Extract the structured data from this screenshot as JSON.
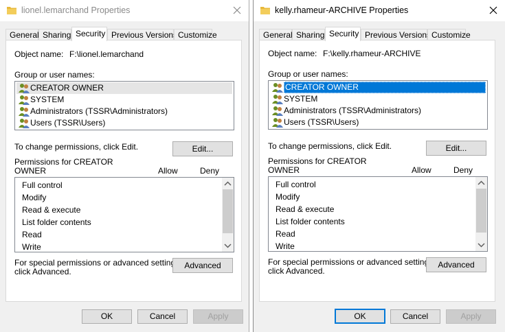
{
  "left": {
    "title": "lionel.lemarchand Properties",
    "tabs": [
      "General",
      "Sharing",
      "Security",
      "Previous Versions",
      "Customize"
    ],
    "object_name_label": "Object name:",
    "object_name_value": "F:\\lionel.lemarchand",
    "group_label": "Group or user names:",
    "users": [
      "CREATOR OWNER",
      "SYSTEM",
      "Administrators (TSSR\\Administrators)",
      "Users (TSSR\\Users)"
    ],
    "change_text": "To change permissions, click Edit.",
    "edit_button": "Edit...",
    "perm_for_line1": "Permissions for CREATOR",
    "perm_for_line2": "OWNER",
    "allow_label": "Allow",
    "deny_label": "Deny",
    "permissions": [
      "Full control",
      "Modify",
      "Read & execute",
      "List folder contents",
      "Read",
      "Write"
    ],
    "special_line1": "For special permissions or advanced settings,",
    "special_line2": "click Advanced.",
    "advanced_button": "Advanced",
    "ok_button": "OK",
    "cancel_button": "Cancel",
    "apply_button": "Apply"
  },
  "right": {
    "title": "kelly.rhameur-ARCHIVE Properties",
    "tabs": [
      "General",
      "Sharing",
      "Security",
      "Previous Versions",
      "Customize"
    ],
    "object_name_label": "Object name:",
    "object_name_value": "F:\\kelly.rhameur-ARCHIVE",
    "group_label": "Group or user names:",
    "users": [
      "CREATOR OWNER",
      "SYSTEM",
      "Administrators (TSSR\\Administrators)",
      "Users (TSSR\\Users)"
    ],
    "change_text": "To change permissions, click Edit.",
    "edit_button": "Edit...",
    "perm_for_line1": "Permissions for CREATOR",
    "perm_for_line2": "OWNER",
    "allow_label": "Allow",
    "deny_label": "Deny",
    "permissions": [
      "Full control",
      "Modify",
      "Read & execute",
      "List folder contents",
      "Read",
      "Write"
    ],
    "special_line1": "For special permissions or advanced settings,",
    "special_line2": "click Advanced.",
    "advanced_button": "Advanced",
    "ok_button": "OK",
    "cancel_button": "Cancel",
    "apply_button": "Apply"
  },
  "colors": {
    "selection_blue": "#0078d7",
    "window_bg": "#f0f0f0",
    "folder_yellow": "#e8b83a"
  },
  "icons": {
    "title": "folder-icon",
    "close": "close-icon",
    "user": "user-group-icon"
  }
}
